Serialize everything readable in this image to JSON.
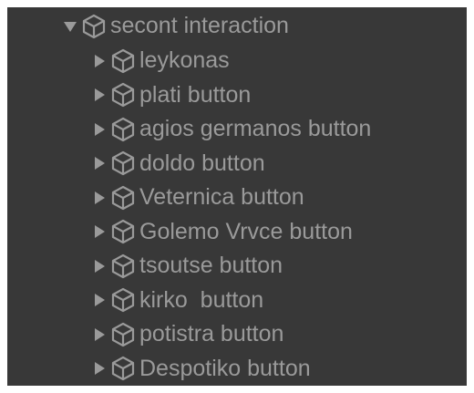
{
  "hierarchy": {
    "parent": {
      "label": "secont interaction",
      "icon": "gameobject-cube-icon",
      "expanded": true
    },
    "children": [
      {
        "label": "leykonas"
      },
      {
        "label": "plati button"
      },
      {
        "label": "agios germanos button"
      },
      {
        "label": "doldo button"
      },
      {
        "label": "Veternica button"
      },
      {
        "label": "Golemo Vrvce button"
      },
      {
        "label": "tsoutse button"
      },
      {
        "label": "kirko  button"
      },
      {
        "label": "potistra button"
      },
      {
        "label": "Despotiko button"
      }
    ]
  },
  "colors": {
    "panel_background": "#383838",
    "text": "#9a9a9a",
    "icon": "#9a9a9a"
  }
}
